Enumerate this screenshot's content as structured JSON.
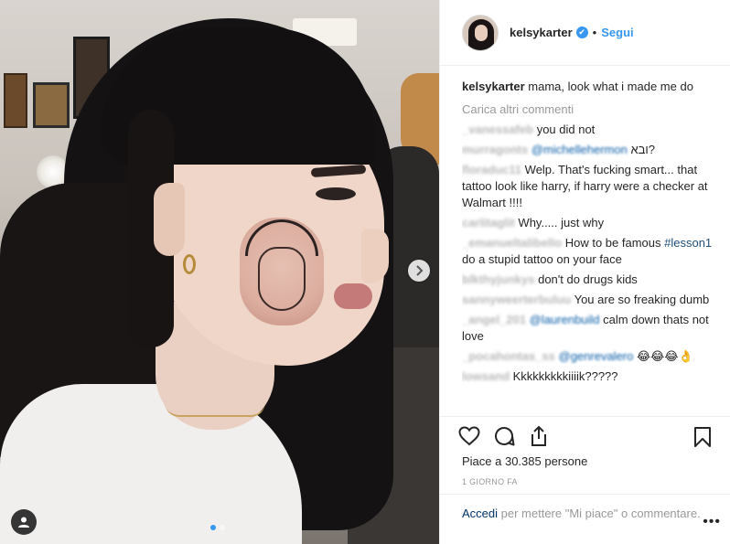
{
  "post": {
    "author": "kelsykarter",
    "separator": "•",
    "follow_label": "Segui",
    "verified_glyph": "✔",
    "caption_text": "mama, look what i made me do",
    "load_more_label": "Carica altri commenti",
    "comments": [
      {
        "user": "_vanessafeb",
        "parts": [
          {
            "t": "text",
            "v": "you did not"
          }
        ]
      },
      {
        "user": "murragonts",
        "parts": [
          {
            "t": "mention",
            "v": "@michellehermon"
          },
          {
            "t": "text",
            "v": " ובא?"
          }
        ]
      },
      {
        "user": "floraduc11",
        "parts": [
          {
            "t": "text",
            "v": "Welp. That's fucking smart... that tattoo look like harry, if harry were a checker at Walmart !!!!"
          }
        ]
      },
      {
        "user": "carlitaglit",
        "parts": [
          {
            "t": "text",
            "v": "Why..... just why"
          }
        ]
      },
      {
        "user": "_emanueltalibello",
        "parts": [
          {
            "t": "text",
            "v": "How to be famous "
          },
          {
            "t": "hashtag",
            "v": "#lesson1"
          },
          {
            "t": "text",
            "v": " do a stupid tattoo on your face"
          }
        ]
      },
      {
        "user": "blkthyjunkys",
        "parts": [
          {
            "t": "text",
            "v": "don't do drugs kids"
          }
        ]
      },
      {
        "user": "sannyweerterbuluu",
        "parts": [
          {
            "t": "text",
            "v": "You are so freaking dumb"
          }
        ]
      },
      {
        "user": "_angel_201",
        "parts": [
          {
            "t": "mention",
            "v": "@laurenbuild"
          },
          {
            "t": "text",
            "v": " calm down thats not love"
          }
        ]
      },
      {
        "user": "_pocahontas_ss",
        "parts": [
          {
            "t": "mention",
            "v": "@genrevalero"
          },
          {
            "t": "text",
            "v": " 😂😂😂👌"
          }
        ]
      },
      {
        "user": "lowsand",
        "parts": [
          {
            "t": "text",
            "v": "Kkkkkkkkkiiiik?????"
          }
        ]
      }
    ],
    "likes_text": "Piace a 30.385 persone",
    "time_text": "1 GIORNO FA",
    "login_label": "Accedi",
    "login_rest": " per mettere \"Mi piace\" o commentare.",
    "more_label": "•••"
  },
  "colors": {
    "link_blue": "#3897f0",
    "text": "#262626",
    "muted": "#999999"
  },
  "icons": {
    "like": "heart-icon",
    "comment": "comment-icon",
    "share": "share-icon",
    "save": "bookmark-icon",
    "next": "chevron-right-icon",
    "tags": "user-tag-icon"
  },
  "carousel": {
    "count": 2,
    "active": 1
  }
}
